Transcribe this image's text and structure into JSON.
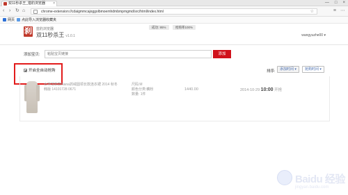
{
  "browser": {
    "tab_title": "双11秒杀王_猎豹浏览器",
    "tab_close": "×",
    "window_controls": [
      "—",
      "□",
      "×"
    ],
    "nav": {
      "back": "‹",
      "forward": "›",
      "reload": "↻",
      "home": "⌂"
    },
    "address_url": "chrome-extension://cdaigmmcajoggolbmoemhdmbmpmgmd/src/html/index.html",
    "star": "☆",
    "toolbar_icons": [
      "≡",
      "⋯"
    ]
  },
  "bookmarks": [
    {
      "label": "网页",
      "icon_color": "#2c6fd6"
    },
    {
      "label": "点此导入浏览器收藏夹",
      "icon_color": "#5b9be6"
    }
  ],
  "app": {
    "brand_small": "蓝豹浏览器",
    "title": "双11秒杀王",
    "version": "v1.0.1",
    "logo_char": "刹",
    "stats": {
      "success_rate": "成功: 95%",
      "fetch_rate": "抢购率100%"
    },
    "user": "wangyuzhe00 ▾"
  },
  "add_bar": {
    "label": "添加宝贝:",
    "placeholder": "粘贴宝贝链接",
    "button": "添加"
  },
  "options": {
    "auto_buy_label": "开启全自动抢购",
    "auto_buy_checked": true,
    "sort_label": "排序:",
    "sort_by_added": "添加时间 ▾",
    "sort_by_start": "抢购时间 ▾"
  },
  "items": [
    {
      "name": "女神范新款Nana抓绒圆领长款连衣裙 2014 秋冬韩版 14101728 0671",
      "detail_line1": "尺码:M",
      "detail_line2": "颜色分类:藕粉",
      "detail_line3": "数量: 1件",
      "price": "1440.00",
      "date": "2014-10-29",
      "time": "10:00",
      "time_suffix": "开抢"
    }
  ],
  "watermark": {
    "text": "Baidu 经验",
    "sub": "jingyan.baidu.com"
  },
  "colors": {
    "primary_red": "#d0111b",
    "highlight_red": "#e21b1b",
    "link_blue": "#4a6fb0"
  }
}
